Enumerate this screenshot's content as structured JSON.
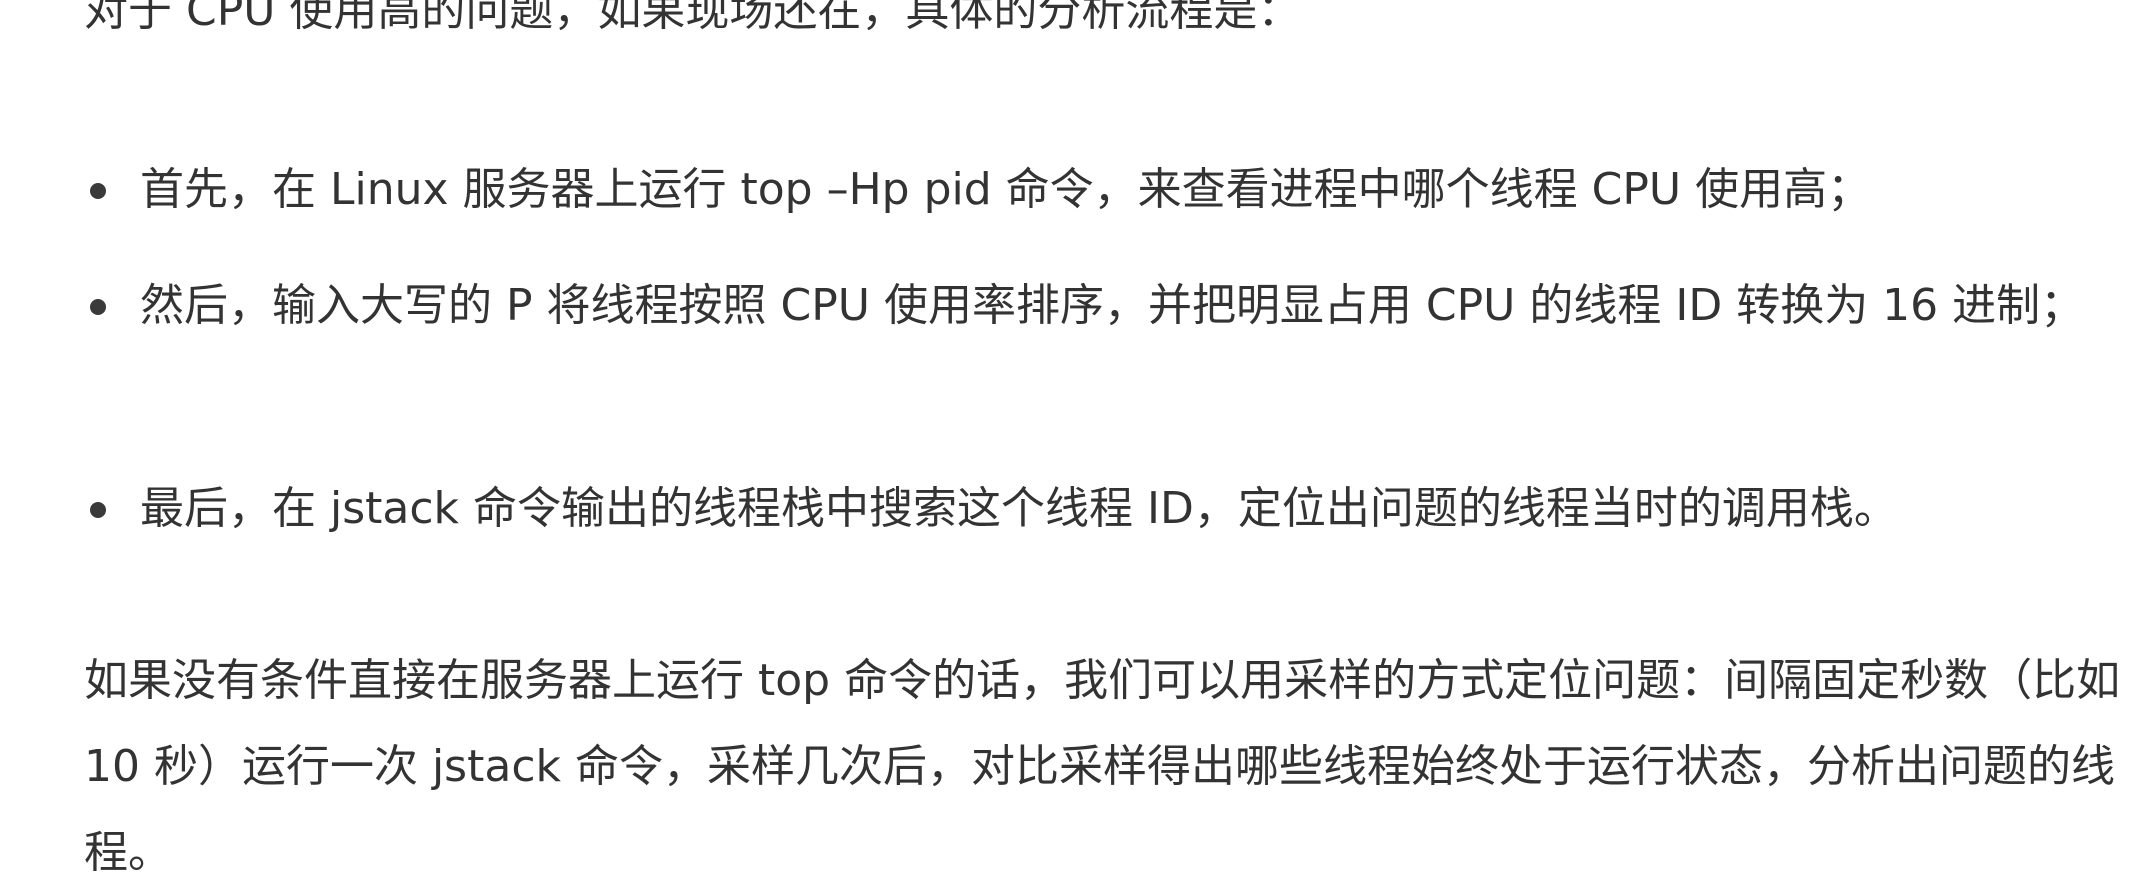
{
  "article": {
    "intro": "对于 CPU 使用高的问题，如果现场还在，具体的分析流程是：",
    "bullets": [
      "首先，在 Linux 服务器上运行 top –Hp pid 命令，来查看进程中哪个线程 CPU 使用高；",
      "然后，输入大写的 P 将线程按照 CPU 使用率排序，并把明显占用 CPU 的线程 ID 转换为 16 进制；",
      "最后，在 jstack 命令输出的线程栈中搜索这个线程 ID，定位出问题的线程当时的调用栈。"
    ],
    "paragraph2": "如果没有条件直接在服务器上运行 top 命令的话，我们可以用采样的方式定位问题：间隔固定秒数（比如 10 秒）运行一次 jstack 命令，采样几次后，对比采样得出哪些线程始终处于运行状态，分析出问题的线程。"
  }
}
